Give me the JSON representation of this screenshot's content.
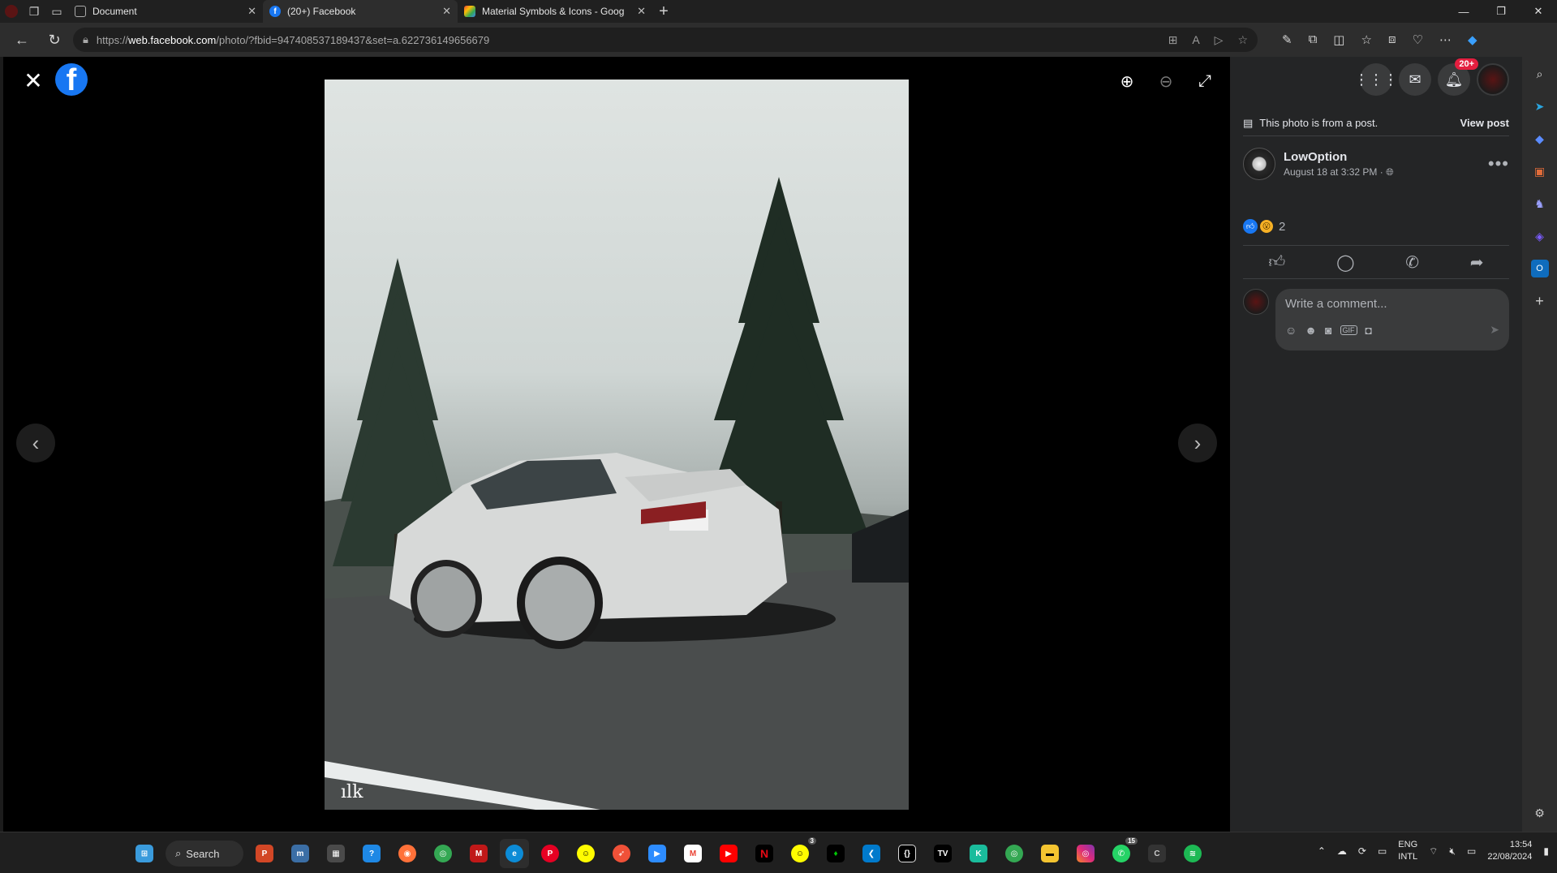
{
  "browser": {
    "tabs": [
      {
        "title": "Document",
        "active": false,
        "favicon": "document-icon"
      },
      {
        "title": "(20+) Facebook",
        "active": true,
        "favicon": "facebook-icon"
      },
      {
        "title": "Material Symbols & Icons - Goog",
        "active": false,
        "favicon": "google-fonts-icon"
      }
    ],
    "url_prefix": "https://",
    "url_host": "web.facebook.com",
    "url_path": "/photo/?fbid=947408537189437&set=a.622736149656679"
  },
  "viewer": {
    "notification_badge": "20+"
  },
  "panel": {
    "from_post_text": "This photo is from a post.",
    "view_post_label": "View post",
    "poster_name": "LowOption",
    "post_date": "August 18 at 3:32 PM · ",
    "reaction_count": "2",
    "comment_placeholder": "Write a comment..."
  },
  "taskbar": {
    "search_label": "Search",
    "lang_line1": "ENG",
    "lang_line2": "INTL",
    "time": "13:54",
    "date": "22/08/2024",
    "snapchat_badge": "3",
    "whatsapp_badge": "15"
  },
  "colors": {
    "facebook_blue": "#1877f2",
    "panel_bg": "#242526",
    "badge_red": "#e41e3f"
  }
}
